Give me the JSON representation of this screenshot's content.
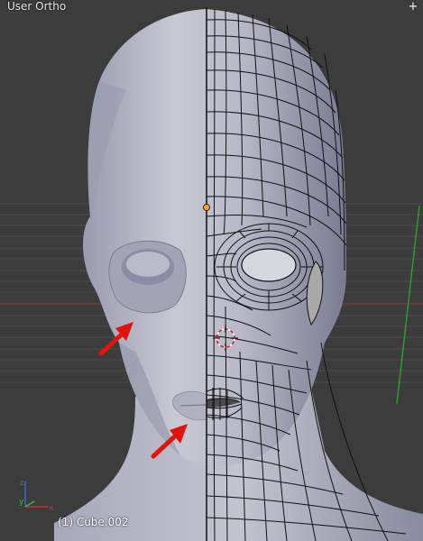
{
  "viewport": {
    "view_label": "User Ortho",
    "object_label": "(1) Cube.002",
    "maximize_glyph": "+"
  },
  "icons": {
    "maximize": "plus-icon",
    "axis_gizmo": "axis-gizmo-icon",
    "cursor": "3d-cursor-icon",
    "origin": "origin-dot-icon",
    "annotation": "red-arrow-icon"
  },
  "colors": {
    "background": "#3c3c3c",
    "mesh_light": "#c9c9d4",
    "mesh_shade": "#8a8aa0",
    "wire": "#111111",
    "annotation_arrow": "#e0140c",
    "axis_x": "#d03030",
    "axis_y": "#30c030",
    "axis_z": "#3a6ad0"
  }
}
